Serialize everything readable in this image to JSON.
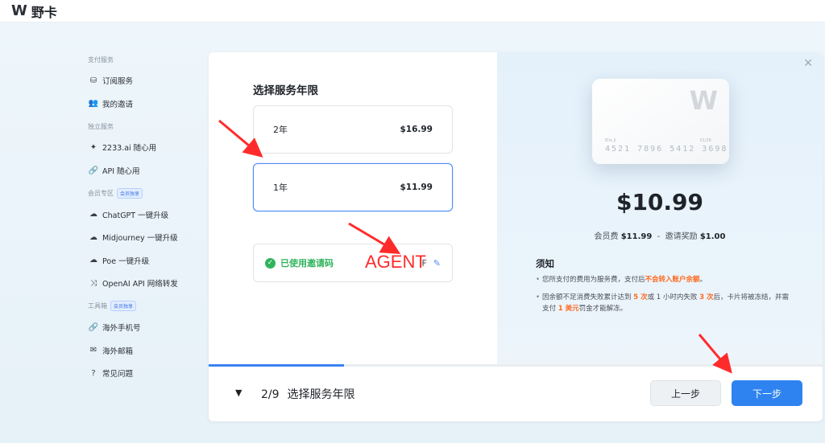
{
  "app": {
    "logo_mark": "W",
    "name": "野卡"
  },
  "sidebar": {
    "sections": [
      {
        "title": "支付服务",
        "badge": "",
        "items": [
          {
            "label": "订阅服务",
            "icon": "coins-icon"
          },
          {
            "label": "我的邀请",
            "icon": "users-icon"
          }
        ]
      },
      {
        "title": "独立服务",
        "badge": "",
        "items": [
          {
            "label": "2233.ai 随心用",
            "icon": "sparkle-icon"
          },
          {
            "label": "API 随心用",
            "icon": "link-icon"
          }
        ]
      },
      {
        "title": "会员专区",
        "badge": "会员独享",
        "items": [
          {
            "label": "ChatGPT 一键升级",
            "icon": "upgrade-icon"
          },
          {
            "label": "Midjourney 一键升级",
            "icon": "upgrade-icon"
          },
          {
            "label": "Poe 一键升级",
            "icon": "upgrade-icon"
          },
          {
            "label": "OpenAI API 网络转发",
            "icon": "shuffle-icon"
          }
        ]
      },
      {
        "title": "工具箱",
        "badge": "会员独享",
        "items": [
          {
            "label": "海外手机号",
            "icon": "link-icon"
          },
          {
            "label": "海外邮箱",
            "icon": "mail-icon"
          },
          {
            "label": "常见问题",
            "icon": "help-icon"
          }
        ]
      }
    ]
  },
  "dialog": {
    "section_title": "选择服务年限",
    "plans": [
      {
        "term": "2年",
        "price": "$16.99",
        "selected": false
      },
      {
        "term": "1年",
        "price": "$11.99",
        "selected": true
      }
    ],
    "invite": {
      "label": "已使用邀请码",
      "code": "F"
    },
    "annotation_text": "AGENT",
    "card": {
      "logo": "W",
      "holder": "Ella Ji",
      "expiry": "01/26",
      "number": "4521 7896 5412 3698"
    },
    "total": "$10.99",
    "fee": {
      "member_label": "会员费",
      "member_value": "$11.99",
      "sep": "-",
      "reward_label": "邀请奖励",
      "reward_value": "$1.00"
    },
    "notice_title": "须知",
    "notice_1": {
      "a": "您所支付的费用为服务费，支付后",
      "b": "不会转入账户余额",
      "c": "。"
    },
    "notice_2": {
      "a": "因余额不足消费失败累计达到 ",
      "b": "5 次",
      "c": "或 1 小时内失败 ",
      "d": "3 次",
      "e": "后，卡片将被冻结，并需支付 ",
      "f": "1 美元",
      "g": "罚金才能解冻。"
    },
    "progress": 0.22,
    "step": {
      "index": "2/9",
      "label": "选择服务年限"
    },
    "prev_label": "上一步",
    "next_label": "下一步",
    "close_icon": "close-icon",
    "accent_color": "#2f83f0",
    "highlight_color": "#ff6a1f"
  }
}
